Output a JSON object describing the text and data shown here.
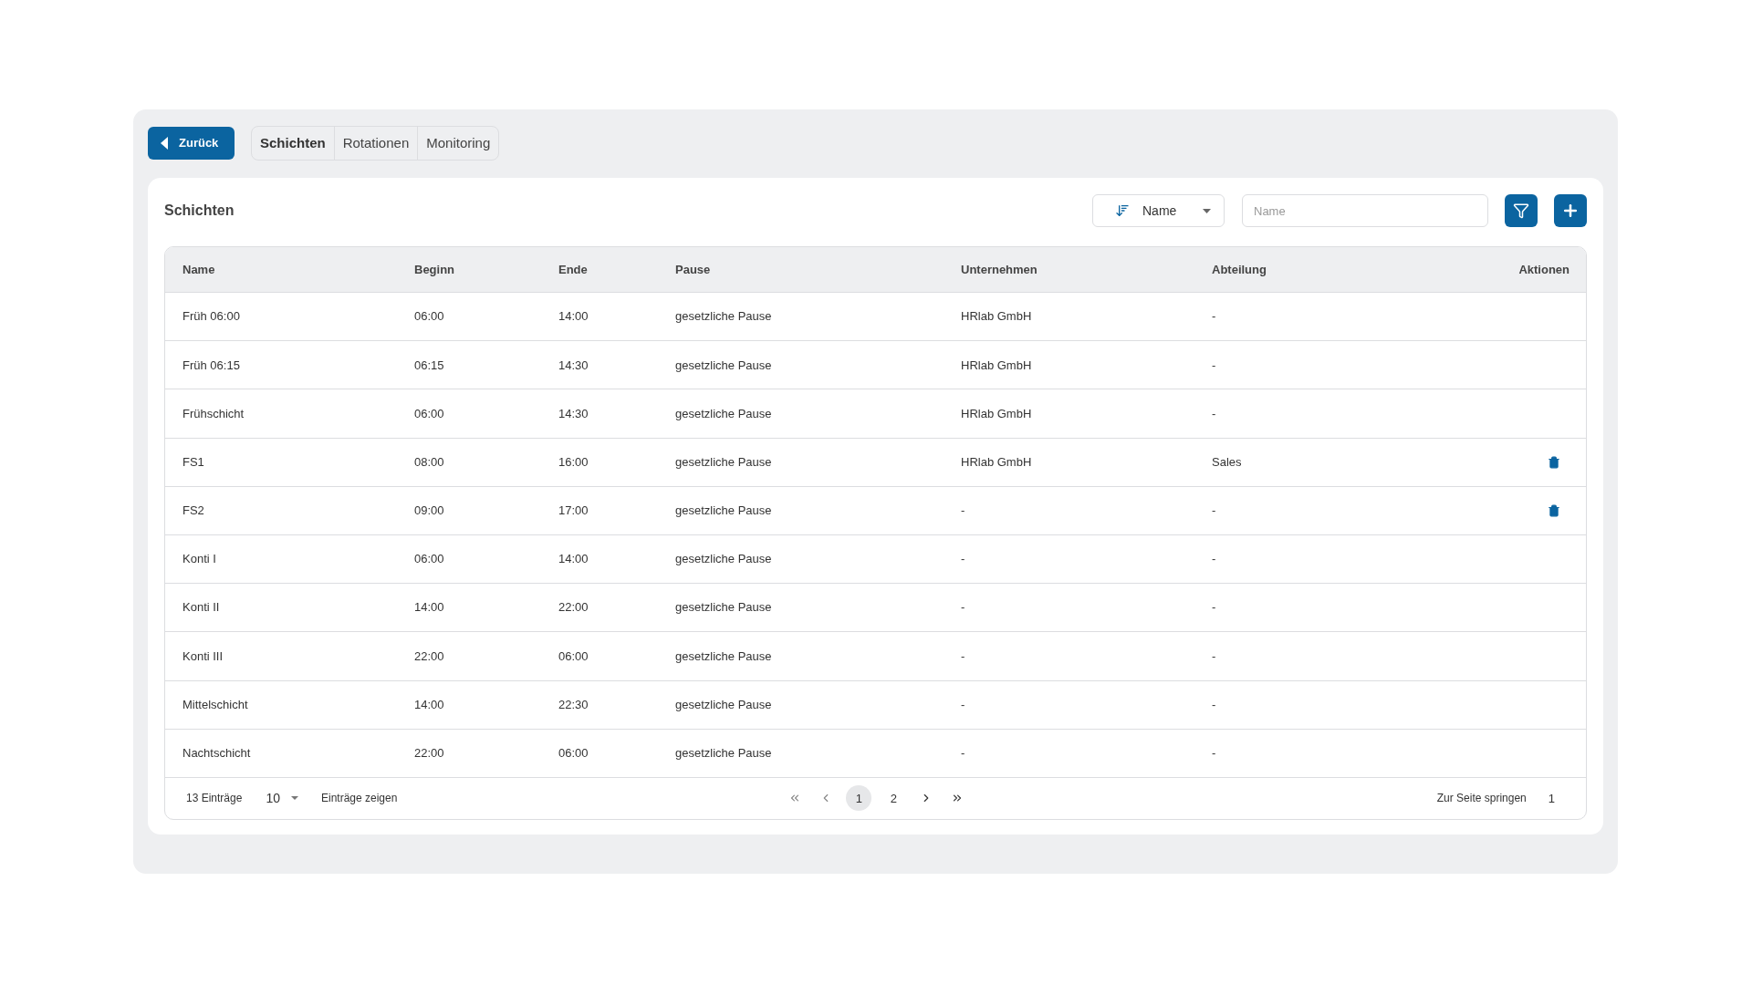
{
  "back_button": {
    "label": "Zurück"
  },
  "tabs": [
    {
      "label": "Schichten",
      "selected": true
    },
    {
      "label": "Rotationen",
      "selected": false
    },
    {
      "label": "Monitoring",
      "selected": false
    }
  ],
  "card": {
    "title": "Schichten",
    "sort": {
      "value": "Name"
    },
    "search": {
      "placeholder": "Name"
    }
  },
  "table": {
    "columns": [
      "Name",
      "Beginn",
      "Ende",
      "Pause",
      "Unternehmen",
      "Abteilung",
      "Aktionen"
    ],
    "rows": [
      {
        "cells": [
          "Früh 06:00",
          "06:00",
          "14:00",
          "gesetzliche Pause",
          "HRlab GmbH",
          "-"
        ],
        "deletable": false
      },
      {
        "cells": [
          "Früh 06:15",
          "06:15",
          "14:30",
          "gesetzliche Pause",
          "HRlab GmbH",
          "-"
        ],
        "deletable": false
      },
      {
        "cells": [
          "Frühschicht",
          "06:00",
          "14:30",
          "gesetzliche Pause",
          "HRlab GmbH",
          "-"
        ],
        "deletable": false
      },
      {
        "cells": [
          "FS1",
          "08:00",
          "16:00",
          "gesetzliche Pause",
          "HRlab GmbH",
          "Sales"
        ],
        "deletable": true
      },
      {
        "cells": [
          "FS2",
          "09:00",
          "17:00",
          "gesetzliche Pause",
          "-",
          "-"
        ],
        "deletable": true
      },
      {
        "cells": [
          "Konti I",
          "06:00",
          "14:00",
          "gesetzliche Pause",
          "-",
          "-"
        ],
        "deletable": false
      },
      {
        "cells": [
          "Konti II",
          "14:00",
          "22:00",
          "gesetzliche Pause",
          "-",
          "-"
        ],
        "deletable": false
      },
      {
        "cells": [
          "Konti III",
          "22:00",
          "06:00",
          "gesetzliche Pause",
          "-",
          "-"
        ],
        "deletable": false
      },
      {
        "cells": [
          "Mittelschicht",
          "14:00",
          "22:30",
          "gesetzliche Pause",
          "-",
          "-"
        ],
        "deletable": false
      },
      {
        "cells": [
          "Nachtschicht",
          "22:00",
          "06:00",
          "gesetzliche Pause",
          "-",
          "-"
        ],
        "deletable": false
      }
    ]
  },
  "footer": {
    "count": "13 Einträge",
    "page_size": "10",
    "page_size_label": "Einträge zeigen",
    "pages": [
      {
        "label": "1",
        "selected": true
      },
      {
        "label": "2",
        "selected": false
      }
    ],
    "jump_label": "Zur Seite springen",
    "jump_value": "1"
  }
}
